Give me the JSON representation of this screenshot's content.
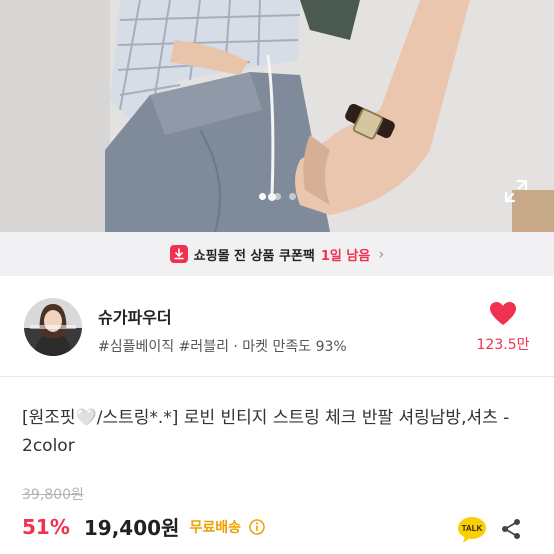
{
  "hero": {
    "image_icon": "product-photo",
    "expand_icon": "expand-icon",
    "slide_count": 3,
    "active_slide": 1
  },
  "coupon": {
    "icon": "coupon-download-icon",
    "text": "쇼핑몰 전 상품 쿠폰팩",
    "days_left": "1일 남음",
    "chevron": "›"
  },
  "shop": {
    "name": "슈가파우더",
    "tags": "#심플베이직 #러블리 · 마켓 만족도 93%",
    "like_count": "123.5만",
    "avatar_icon": "shop-avatar"
  },
  "product": {
    "title": "[원조핏🤍/스트링*.*] 로빈 빈티지 스트링 체크 반팔 셔링남방,셔츠 - 2color",
    "original_price": "39,800원",
    "discount": "51%",
    "price": "19,400원",
    "shipping": "무료배송"
  },
  "actions": {
    "talk_label": "TALK",
    "share_icon": "share-icon"
  },
  "colors": {
    "accent": "#f2304f",
    "shipping": "#f0a000"
  }
}
